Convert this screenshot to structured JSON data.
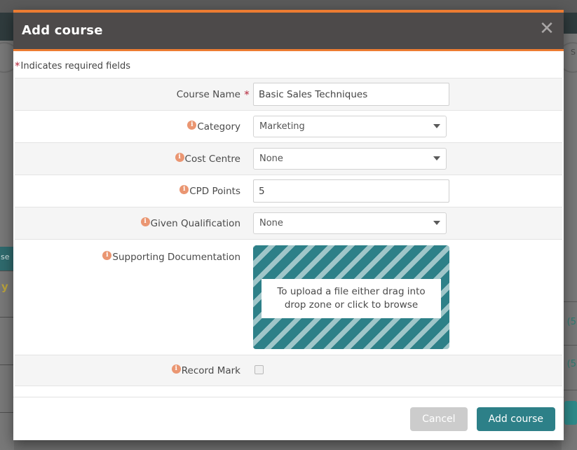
{
  "modal": {
    "title": "Add course",
    "close_icon": "close-icon",
    "required_note": "Indicates required fields",
    "required_star": "*",
    "accent_top_color": "#ec7c32",
    "header_bg_color": "#4d4a4a"
  },
  "fields": [
    {
      "label": "Course Name",
      "icon": null,
      "required_star": "*",
      "type": "text",
      "value": "Basic Sales Techniques",
      "row_style": "alt"
    },
    {
      "label": "Category",
      "icon": "info-icon",
      "icon_glyph": "i",
      "required_star": "",
      "type": "select",
      "value": "Marketing",
      "row_style": "plain"
    },
    {
      "label": "Cost Centre",
      "icon": "info-icon",
      "icon_glyph": "i",
      "required_star": "",
      "type": "select",
      "value": "None",
      "row_style": "alt"
    },
    {
      "label": "CPD Points",
      "icon": "info-icon",
      "icon_glyph": "i",
      "required_star": "",
      "type": "text",
      "value": "5",
      "row_style": "plain"
    },
    {
      "label": "Given Qualification",
      "icon": "info-icon",
      "icon_glyph": "i",
      "required_star": "",
      "type": "select",
      "value": "None",
      "row_style": "alt"
    },
    {
      "label": "Supporting Documentation",
      "icon": "info-icon",
      "icon_glyph": "i",
      "required_star": "",
      "type": "dropzone",
      "value": "To upload a file either drag into drop zone or click to browse",
      "row_style": "plain"
    },
    {
      "label": "Record Mark",
      "icon": "info-icon",
      "icon_glyph": "i",
      "required_star": "",
      "type": "checkbox",
      "value": "",
      "row_style": "alt"
    }
  ],
  "dropzone": {
    "text": "To upload a file either drag into drop zone or click to browse",
    "stripe_color": "#2d8088"
  },
  "footer": {
    "cancel_label": "Cancel",
    "submit_label": "Add course",
    "cancel_color": "#cccccc",
    "submit_color": "#2d8088"
  },
  "background": {
    "right_text": "S",
    "left_text": "se",
    "left_accent": "y",
    "paren_1": "(5",
    "paren_2": "(5"
  }
}
